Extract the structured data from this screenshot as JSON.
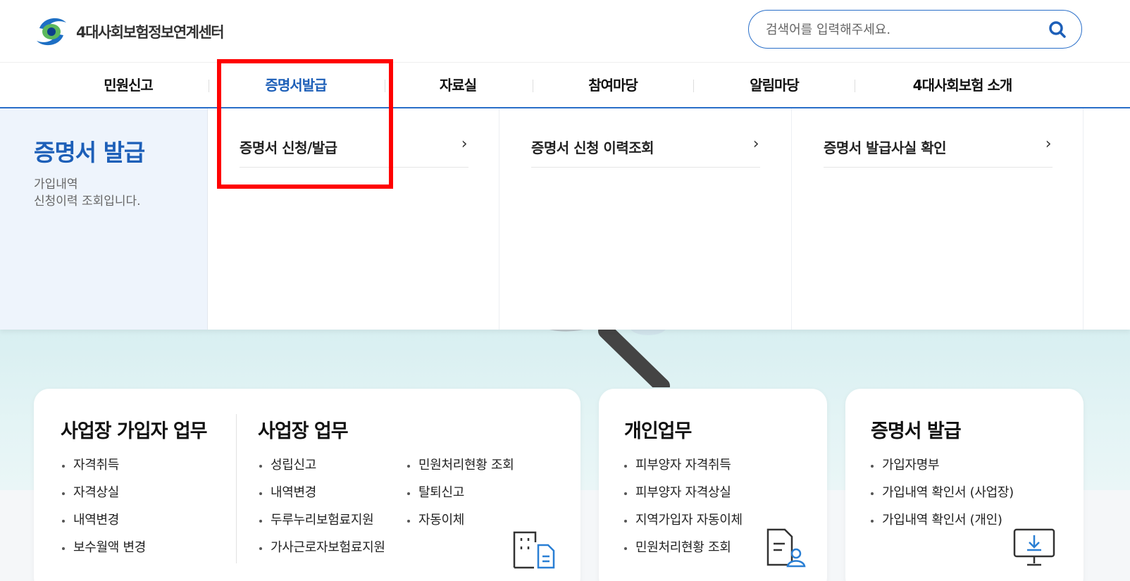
{
  "header": {
    "logo_text": "4대사회보험정보연계센터",
    "search_placeholder": "검색어를 입력해주세요."
  },
  "nav": {
    "items": [
      {
        "label": "민원신고"
      },
      {
        "label": "증명서발급"
      },
      {
        "label": "자료실"
      },
      {
        "label": "참여마당"
      },
      {
        "label": "알림마당"
      },
      {
        "label": "4대사회보험 소개"
      }
    ],
    "active_index": 1
  },
  "dropdown": {
    "title": "증명서 발급",
    "description": "가입내역\n신청이력 조회입니다.",
    "links": [
      {
        "label": "증명서 신청/발급",
        "arrow": "›"
      },
      {
        "label": "증명서 신청 이력조회",
        "arrow": "›"
      },
      {
        "label": "증명서 발급사실 확인",
        "arrow": "›"
      }
    ]
  },
  "cards": {
    "business_member": {
      "title": "사업장 가입자 업무",
      "items": [
        "자격취득",
        "자격상실",
        "내역변경",
        "보수월액 변경"
      ]
    },
    "business": {
      "title": "사업장 업무",
      "items_left": [
        "성립신고",
        "내역변경",
        "두루누리보험료지원",
        "가사근로자보험료지원"
      ],
      "items_right": [
        "민원처리현황 조회",
        "탈퇴신고",
        "자동이체"
      ]
    },
    "personal": {
      "title": "개인업무",
      "items": [
        "피부양자 자격취득",
        "피부양자 자격상실",
        "지역가입자 자동이체",
        "민원처리현황 조회"
      ]
    },
    "certificate": {
      "title": "증명서 발급",
      "items": [
        "가입자명부",
        "가입내역 확인서 (사업장)",
        "가입내역 확인서 (개인)"
      ]
    }
  },
  "colors": {
    "accent": "#1d5fb8",
    "highlight": "#ff0000",
    "side_panel": "#eef4fc"
  }
}
